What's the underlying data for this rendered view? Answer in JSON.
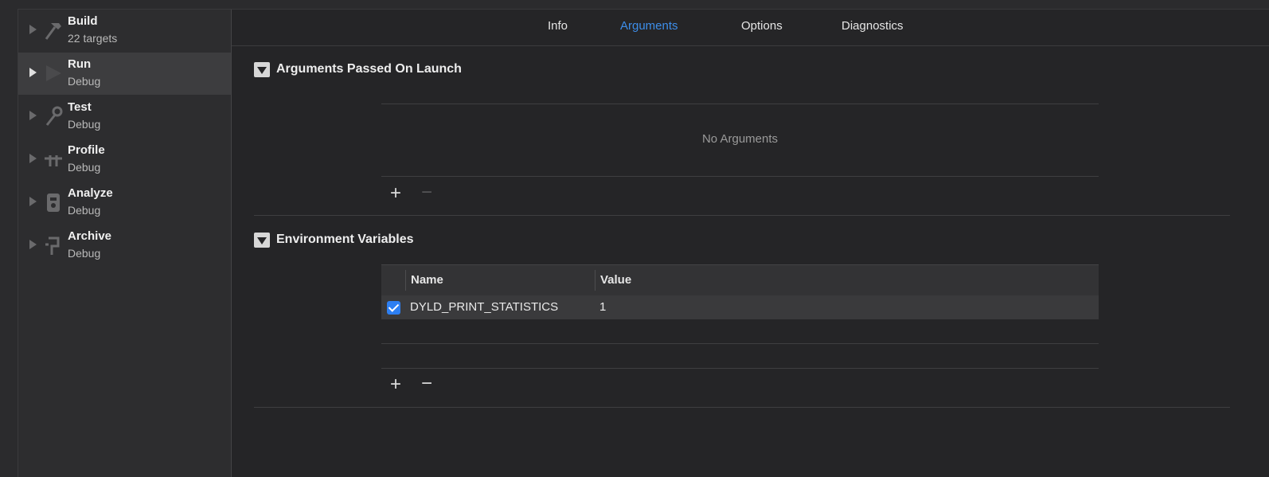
{
  "sidebar": {
    "items": [
      {
        "title": "Build",
        "subtitle": "22 targets",
        "icon": "hammer-icon",
        "selected": false
      },
      {
        "title": "Run",
        "subtitle": "Debug",
        "icon": "play-icon",
        "selected": true
      },
      {
        "title": "Test",
        "subtitle": "Debug",
        "icon": "wrench-icon",
        "selected": false
      },
      {
        "title": "Profile",
        "subtitle": "Debug",
        "icon": "gauge-icon",
        "selected": false
      },
      {
        "title": "Analyze",
        "subtitle": "Debug",
        "icon": "analyze-icon",
        "selected": false
      },
      {
        "title": "Archive",
        "subtitle": "Debug",
        "icon": "archive-icon",
        "selected": false
      }
    ]
  },
  "tabs": [
    {
      "label": "Info",
      "active": false
    },
    {
      "label": "Arguments",
      "active": true
    },
    {
      "label": "Options",
      "active": false
    },
    {
      "label": "Diagnostics",
      "active": false
    }
  ],
  "arguments_section": {
    "title": "Arguments Passed On Launch",
    "empty_text": "No Arguments",
    "add_label": "+",
    "remove_label": "−"
  },
  "env_section": {
    "title": "Environment Variables",
    "columns": {
      "name": "Name",
      "value": "Value"
    },
    "rows": [
      {
        "enabled": true,
        "name": "DYLD_PRINT_STATISTICS",
        "value": "1"
      }
    ],
    "add_label": "+",
    "remove_label": "−"
  },
  "colors": {
    "accent": "#3d8eea",
    "checkbox": "#2d7ff2",
    "background": "#252527"
  }
}
